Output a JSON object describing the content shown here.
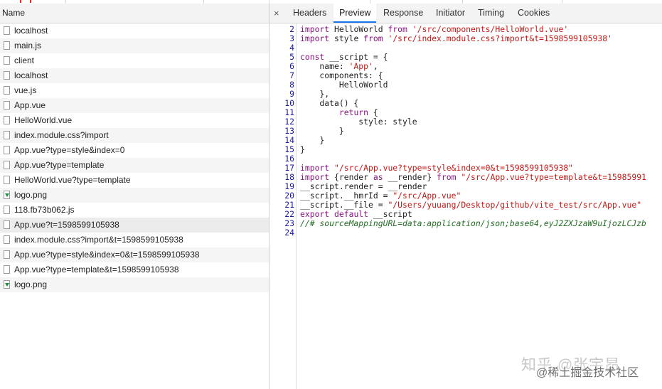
{
  "network_panel": {
    "column_header": "Name",
    "requests": [
      {
        "name": "localhost",
        "type": "doc"
      },
      {
        "name": "main.js",
        "type": "doc"
      },
      {
        "name": "client",
        "type": "doc"
      },
      {
        "name": "localhost",
        "type": "doc"
      },
      {
        "name": "vue.js",
        "type": "doc"
      },
      {
        "name": "App.vue",
        "type": "doc"
      },
      {
        "name": "HelloWorld.vue",
        "type": "doc"
      },
      {
        "name": "index.module.css?import",
        "type": "doc"
      },
      {
        "name": "App.vue?type=style&index=0",
        "type": "doc"
      },
      {
        "name": "App.vue?type=template",
        "type": "doc"
      },
      {
        "name": "HelloWorld.vue?type=template",
        "type": "doc"
      },
      {
        "name": "logo.png",
        "type": "image"
      },
      {
        "name": "118.fb73b062.js",
        "type": "doc"
      },
      {
        "name": "App.vue?t=1598599105938",
        "type": "doc",
        "selected": true
      },
      {
        "name": "index.module.css?import&t=1598599105938",
        "type": "doc"
      },
      {
        "name": "App.vue?type=style&index=0&t=1598599105938",
        "type": "doc"
      },
      {
        "name": "App.vue?type=template&t=1598599105938",
        "type": "doc"
      },
      {
        "name": "logo.png",
        "type": "image"
      }
    ]
  },
  "detail_tabs": {
    "close": "×",
    "tabs": [
      "Headers",
      "Preview",
      "Response",
      "Initiator",
      "Timing",
      "Cookies"
    ],
    "active": "Preview"
  },
  "code_lines": [
    {
      "num": "2",
      "segments": [
        [
          "k",
          "import"
        ],
        [
          "p",
          " HelloWorld "
        ],
        [
          "k",
          "from"
        ],
        [
          "p",
          " "
        ],
        [
          "s",
          "'/src/components/HelloWorld.vue'"
        ]
      ]
    },
    {
      "num": "3",
      "segments": [
        [
          "k",
          "import"
        ],
        [
          "p",
          " style "
        ],
        [
          "k",
          "from"
        ],
        [
          "p",
          " "
        ],
        [
          "s",
          "'/src/index.module.css?import&t=1598599105938'"
        ]
      ]
    },
    {
      "num": "4",
      "segments": []
    },
    {
      "num": "5",
      "segments": [
        [
          "k",
          "const"
        ],
        [
          "p",
          " __script = {"
        ]
      ]
    },
    {
      "num": "6",
      "segments": [
        [
          "p",
          "    name: "
        ],
        [
          "s",
          "'App'"
        ],
        [
          "p",
          ","
        ]
      ]
    },
    {
      "num": "7",
      "segments": [
        [
          "p",
          "    components: {"
        ]
      ]
    },
    {
      "num": "8",
      "segments": [
        [
          "p",
          "        HelloWorld"
        ]
      ]
    },
    {
      "num": "9",
      "segments": [
        [
          "p",
          "    },"
        ]
      ]
    },
    {
      "num": "10",
      "segments": [
        [
          "p",
          "    data() {"
        ]
      ]
    },
    {
      "num": "11",
      "segments": [
        [
          "p",
          "        "
        ],
        [
          "k",
          "return"
        ],
        [
          "p",
          " {"
        ]
      ]
    },
    {
      "num": "12",
      "segments": [
        [
          "p",
          "            style: style"
        ]
      ]
    },
    {
      "num": "13",
      "segments": [
        [
          "p",
          "        }"
        ]
      ]
    },
    {
      "num": "14",
      "segments": [
        [
          "p",
          "    }"
        ]
      ]
    },
    {
      "num": "15",
      "segments": [
        [
          "p",
          "}"
        ]
      ]
    },
    {
      "num": "16",
      "segments": []
    },
    {
      "num": "17",
      "segments": [
        [
          "k",
          "import"
        ],
        [
          "p",
          " "
        ],
        [
          "s",
          "\"/src/App.vue?type=style&index=0&t=1598599105938\""
        ]
      ]
    },
    {
      "num": "18",
      "segments": [
        [
          "k",
          "import"
        ],
        [
          "p",
          " {render "
        ],
        [
          "k",
          "as"
        ],
        [
          "p",
          " __render} "
        ],
        [
          "k",
          "from"
        ],
        [
          "p",
          " "
        ],
        [
          "s",
          "\"/src/App.vue?type=template&t=15985991"
        ]
      ]
    },
    {
      "num": "19",
      "segments": [
        [
          "p",
          "__script.render = __render"
        ]
      ]
    },
    {
      "num": "20",
      "segments": [
        [
          "p",
          "__script.__hmrId = "
        ],
        [
          "s",
          "\"/src/App.vue\""
        ]
      ]
    },
    {
      "num": "21",
      "segments": [
        [
          "p",
          "__script.__file = "
        ],
        [
          "s",
          "\"/Users/yuuang/Desktop/github/vite_test/src/App.vue\""
        ]
      ]
    },
    {
      "num": "22",
      "segments": [
        [
          "k",
          "export"
        ],
        [
          "p",
          " "
        ],
        [
          "k",
          "default"
        ],
        [
          "p",
          " __script"
        ]
      ]
    },
    {
      "num": "23",
      "segments": [
        [
          "c",
          "//# sourceMappingURL=data:application/json;base64,eyJ2ZXJzaW9uIjozLCJzb"
        ]
      ]
    },
    {
      "num": "24",
      "segments": []
    }
  ],
  "watermark": {
    "line1": "知乎 @张宇昂",
    "line2": "@稀土掘金技术社区"
  },
  "colors": {
    "keyword": "#881280",
    "string": "#c41a16",
    "comment": "#236e25",
    "line_number": "#1a1aa6",
    "active_tab_underline": "#1a73e8",
    "image_icon": "#1e8e3e"
  }
}
